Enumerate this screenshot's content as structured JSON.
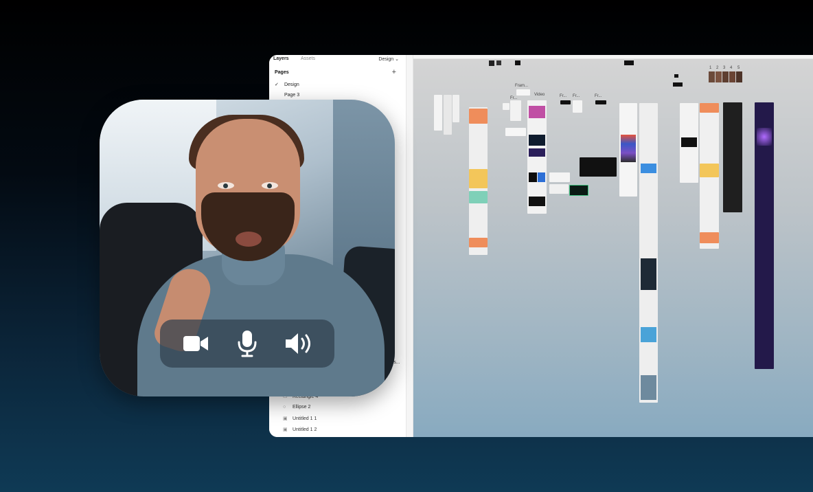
{
  "layers_panel": {
    "tabs": {
      "layers": "Layers",
      "assets": "Assets",
      "page_select": "Design ⌄"
    },
    "pages_header": "Pages",
    "add_page": "+",
    "pages": [
      {
        "label": "Design",
        "current": true,
        "check": "✓"
      },
      {
        "label": "Page 3",
        "current": false,
        "check": ""
      }
    ],
    "layers": [
      {
        "label": "Rectangle 4",
        "icon": "rectangle-icon",
        "glyph": "▭"
      },
      {
        "label": "Ellipse 2",
        "icon": "ellipse-icon",
        "glyph": "○"
      },
      {
        "label": "Untitled 1 1",
        "icon": "image-icon",
        "glyph": "▣"
      },
      {
        "label": "Untitled 1 2",
        "icon": "image-icon",
        "glyph": "▣"
      }
    ],
    "truncated_label": "ers..."
  },
  "canvas": {
    "frame_labels": [
      "Fram...",
      "Fr...",
      "Fr...",
      "Fr...",
      "Fr...",
      "Video"
    ],
    "numbered_tabs": [
      "1",
      "2",
      "3",
      "4",
      "5"
    ]
  },
  "call_controls": [
    {
      "name": "camera-button",
      "icon": "video-camera-icon"
    },
    {
      "name": "microphone-button",
      "icon": "microphone-icon"
    },
    {
      "name": "speaker-button",
      "icon": "speaker-volume-icon"
    }
  ],
  "colors": {
    "control_icon": "#ffffff",
    "control_bar": "#30404e",
    "orange_frame": "#ef8d5b",
    "yellow_frame": "#f3c65a",
    "purple_frame": "#23194a"
  }
}
